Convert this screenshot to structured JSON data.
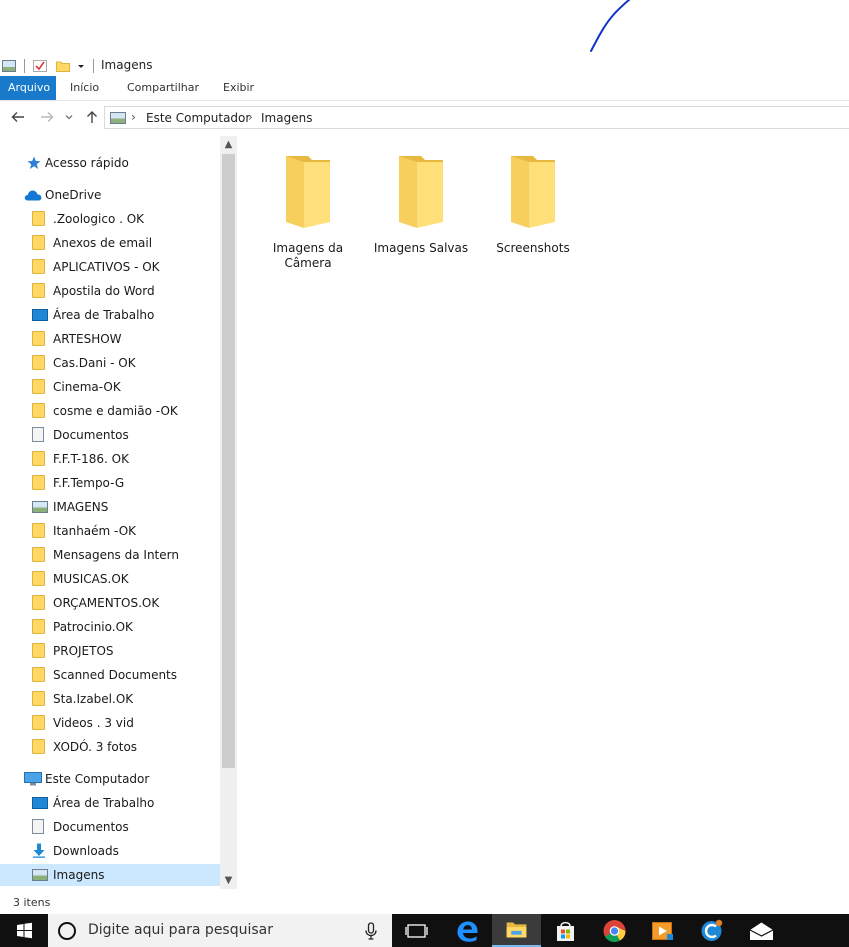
{
  "window": {
    "title": "Imagens"
  },
  "ribbon": {
    "tabs": [
      "Arquivo",
      "Início",
      "Compartilhar",
      "Exibir"
    ]
  },
  "address": {
    "crumbs": [
      "Este Computador",
      "Imagens"
    ]
  },
  "nav_pane": {
    "quick_access": "Acesso rápido",
    "onedrive": "OneDrive",
    "onedrive_items": [
      {
        "label": ".Zoologico . OK",
        "icon": "folder-icon"
      },
      {
        "label": "Anexos de email",
        "icon": "folder-icon"
      },
      {
        "label": "APLICATIVOS - OK",
        "icon": "folder-icon"
      },
      {
        "label": "Apostila do Word",
        "icon": "folder-icon"
      },
      {
        "label": "Área de Trabalho",
        "icon": "desktop-icon"
      },
      {
        "label": "ARTESHOW",
        "icon": "folder-icon"
      },
      {
        "label": "Cas.Dani - OK",
        "icon": "folder-icon"
      },
      {
        "label": "Cinema-OK",
        "icon": "folder-icon"
      },
      {
        "label": "cosme e damião -OK",
        "icon": "folder-icon"
      },
      {
        "label": "Documentos",
        "icon": "documents-icon"
      },
      {
        "label": "F.F.T-186. OK",
        "icon": "folder-icon"
      },
      {
        "label": "F.F.Tempo-G",
        "icon": "folder-icon"
      },
      {
        "label": "IMAGENS",
        "icon": "pictures-icon"
      },
      {
        "label": "Itanhaém -OK",
        "icon": "folder-icon"
      },
      {
        "label": "Mensagens da Intern",
        "icon": "folder-icon"
      },
      {
        "label": "MUSICAS.OK",
        "icon": "folder-icon"
      },
      {
        "label": "ORÇAMENTOS.OK",
        "icon": "folder-icon"
      },
      {
        "label": "Patrocinio.OK",
        "icon": "folder-icon"
      },
      {
        "label": "PROJETOS",
        "icon": "folder-icon"
      },
      {
        "label": "Scanned Documents",
        "icon": "folder-icon"
      },
      {
        "label": "Sta.Izabel.OK",
        "icon": "folder-icon"
      },
      {
        "label": "Videos . 3 vid",
        "icon": "folder-icon"
      },
      {
        "label": "XODÓ. 3 fotos",
        "icon": "folder-icon"
      }
    ],
    "this_pc": "Este Computador",
    "this_pc_items": [
      {
        "label": "Área de Trabalho",
        "icon": "desktop-icon"
      },
      {
        "label": "Documentos",
        "icon": "documents-icon"
      },
      {
        "label": "Downloads",
        "icon": "download-icon"
      },
      {
        "label": "Imagens",
        "icon": "pictures-icon",
        "selected": true
      }
    ]
  },
  "content": {
    "folders": [
      {
        "label": "Imagens da Câmera"
      },
      {
        "label": "Imagens Salvas"
      },
      {
        "label": "Screenshots"
      }
    ]
  },
  "status": {
    "item_count": "3 itens"
  },
  "taskbar": {
    "search_placeholder": "Digite aqui para pesquisar",
    "pinned_icons": [
      "task-view-icon",
      "edge-icon",
      "file-explorer-icon",
      "store-icon",
      "chrome-icon",
      "media-player-icon",
      "ccleaner-icon",
      "mail-icon"
    ]
  },
  "colors": {
    "accent": "#1979ca",
    "folder": "#ffd866",
    "selection": "#cce8ff",
    "taskbar": "#101010"
  }
}
